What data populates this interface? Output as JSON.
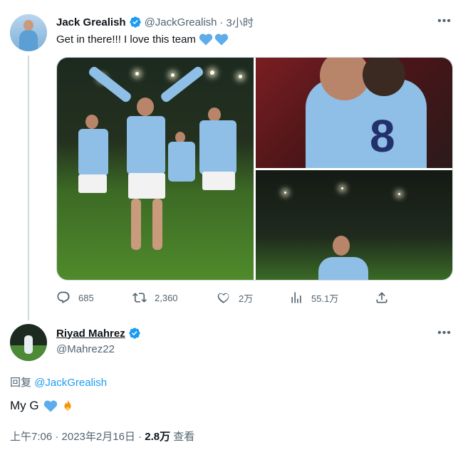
{
  "colors": {
    "accent": "#1d9bf0",
    "secondary_text": "#536471",
    "primary_text": "#0f1419",
    "thread_line": "#cfd9de"
  },
  "tweet": {
    "author_name": "Jack Grealish",
    "verified": true,
    "handle": "@JackGrealish",
    "separator": "·",
    "time": "3小时",
    "text": "Get in there!!! I love this team",
    "emojis": [
      "blue-heart-icon",
      "blue-heart-icon"
    ],
    "media_count": 3,
    "actions": {
      "reply_count": "685",
      "retweet_count": "2,360",
      "like_count": "2万",
      "view_count": "55.1万"
    }
  },
  "reply": {
    "author_name": "Riyad Mahrez",
    "verified": true,
    "handle": "@Mahrez22",
    "replying_prefix": "回复",
    "replying_to": "@JackGrealish",
    "text": "My G",
    "emojis": [
      "blue-heart-icon",
      "fire-icon"
    ],
    "timestamp": "上午7:06 · 2023年2月16日 ·",
    "views": "2.8万",
    "views_label": "查看"
  }
}
